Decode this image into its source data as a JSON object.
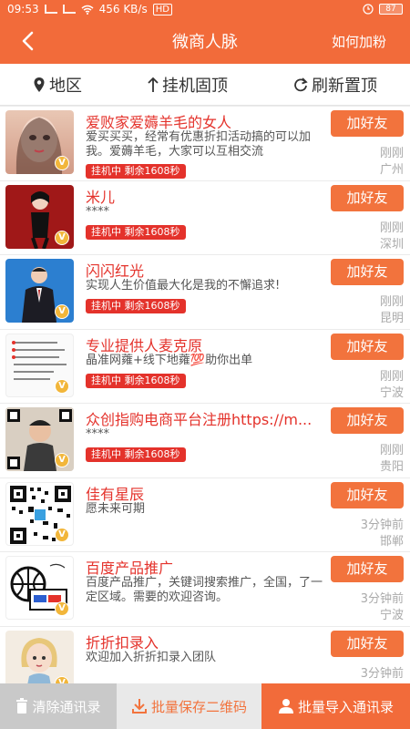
{
  "status": {
    "time": "09:53",
    "speed": "456 KB/s",
    "hd": "HD",
    "battery": "87"
  },
  "header": {
    "title": "微商人脉",
    "right": "如何加粉"
  },
  "filters": [
    {
      "icon": "location-pin-icon",
      "label": "地区"
    },
    {
      "icon": "up-arrow-icon",
      "label": "挂机固顶"
    },
    {
      "icon": "refresh-icon",
      "label": "刷新置顶"
    }
  ],
  "items": [
    {
      "name": "爱败家爱薅羊毛的女人",
      "desc": "爱买买买，经常有优惠折扣活动搞的可以加我。爱薅羊毛，大家可以互相交流",
      "tag": "挂机中 剩余1608秒",
      "time": "刚刚",
      "city": "广州",
      "add": "加好友"
    },
    {
      "name": "米儿",
      "desc": "****",
      "tag": "挂机中 剩余1608秒",
      "time": "刚刚",
      "city": "深圳",
      "add": "加好友"
    },
    {
      "name": "闪闪红光",
      "desc": "实现人生价值最大化是我的不懈追求!",
      "tag": "挂机中 剩余1608秒",
      "time": "刚刚",
      "city": "昆明",
      "add": "加好友"
    },
    {
      "name": "专业提供人麦克原",
      "desc": "晶准网蕹+线下地蕹💯助你出单",
      "tag": "挂机中 剩余1608秒",
      "time": "刚刚",
      "city": "宁波",
      "add": "加好友"
    },
    {
      "name": "众创指购电商平台注册https://m...",
      "desc": "****",
      "tag": "挂机中 剩余1608秒",
      "time": "刚刚",
      "city": "贵阳",
      "add": "加好友"
    },
    {
      "name": "佳有星辰",
      "desc": "愿未来可期",
      "tag": "",
      "time": "3分钟前",
      "city": "邯郸",
      "add": "加好友"
    },
    {
      "name": "百度产品推广",
      "desc": "百度产品推广，关键词搜索推广，全国，了一定区域。需要的欢迎咨询。",
      "tag": "",
      "time": "3分钟前",
      "city": "宁波",
      "add": "加好友"
    },
    {
      "name": "折折扣录入",
      "desc": "欢迎加入折折扣录入团队",
      "tag": "",
      "time": "3分钟前",
      "city": "",
      "add": "加好友"
    }
  ],
  "bottom": {
    "clear": "清除通讯录",
    "save_qr": "批量保存二维码",
    "import": "批量导入通讯录"
  },
  "colors": {
    "primary": "#f26b3a",
    "tag_red": "#e4322b",
    "button_orange": "#f2733d"
  }
}
